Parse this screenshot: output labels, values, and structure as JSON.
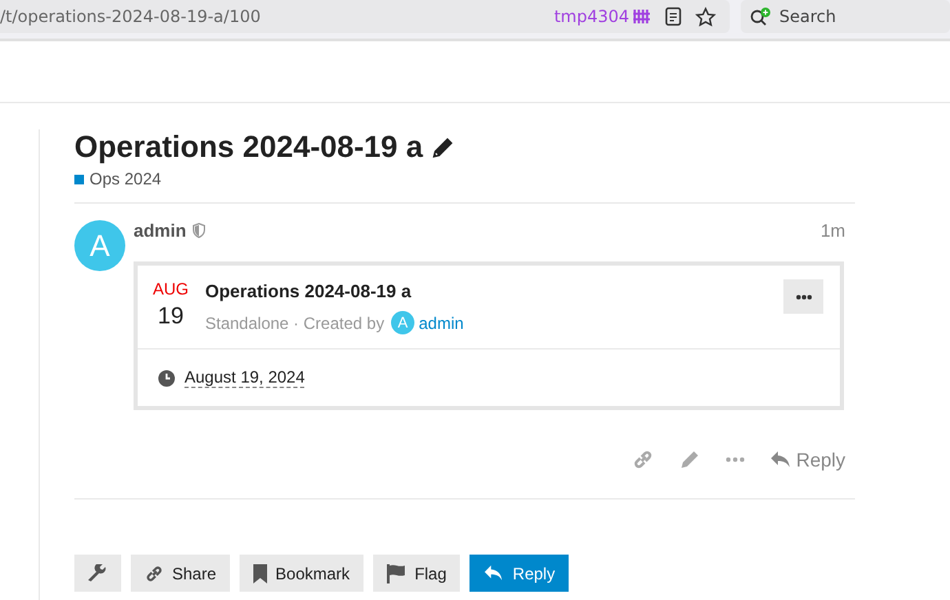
{
  "browser": {
    "url": "/t/operations-2024-08-19-a/100",
    "container_label": "tmp4304",
    "search": {
      "placeholder": "Search"
    }
  },
  "topic": {
    "title": "Operations 2024-08-19 a",
    "category": {
      "name": "Ops 2024",
      "color": "#0088cc"
    }
  },
  "post": {
    "avatar_letter": "A",
    "username": "admin",
    "age": "1m",
    "event": {
      "month": "AUG",
      "day": "19",
      "title": "Operations 2024-08-19 a",
      "meta": "Standalone · Created by",
      "creator_avatar_letter": "A",
      "creator": "admin",
      "date": "August 19, 2024"
    },
    "actions": [
      {
        "kind": "link"
      },
      {
        "kind": "edit"
      },
      {
        "kind": "more"
      },
      {
        "kind": "reply",
        "label": "Reply"
      }
    ]
  },
  "footer_buttons": [
    {
      "kind": "admin",
      "primary": false
    },
    {
      "kind": "share",
      "label": "Share",
      "primary": false
    },
    {
      "kind": "bookmark",
      "label": "Bookmark",
      "primary": false
    },
    {
      "kind": "flag",
      "label": "Flag",
      "primary": false
    },
    {
      "kind": "reply",
      "label": "Reply",
      "primary": true
    }
  ]
}
